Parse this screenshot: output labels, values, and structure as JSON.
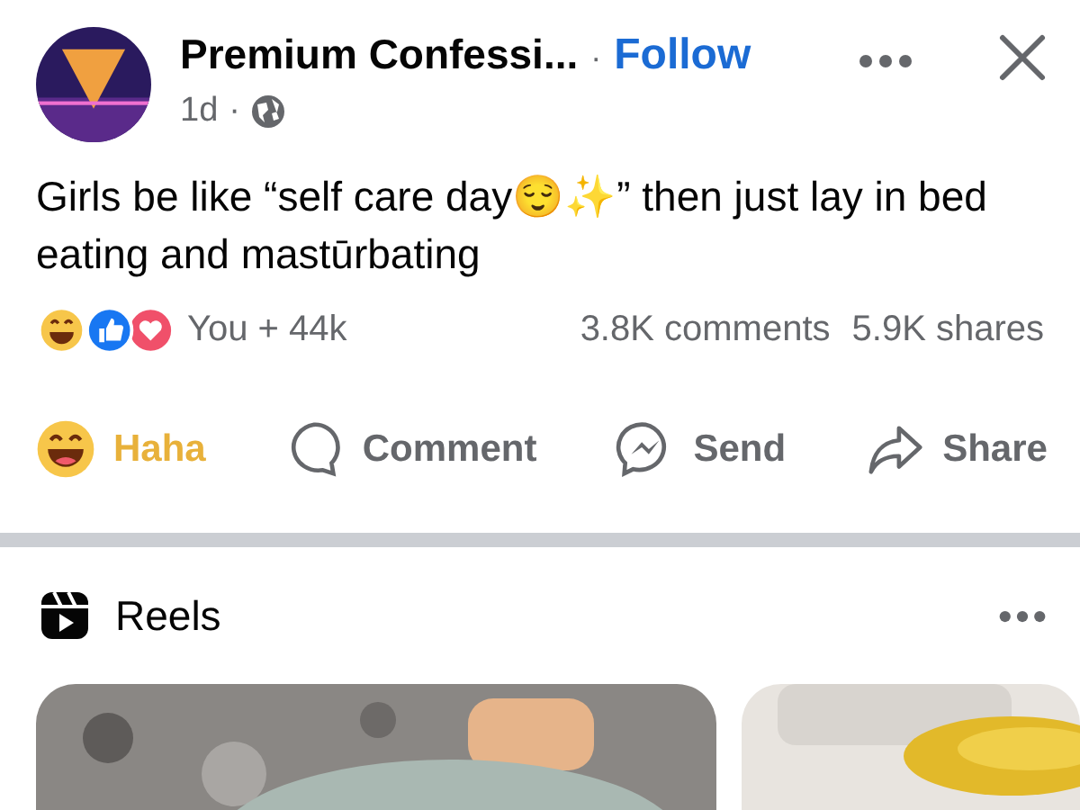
{
  "post": {
    "author": "Premium Confessi...",
    "separator": "·",
    "follow": "Follow",
    "time": "1d",
    "time_separator": "·",
    "text": "Girls be like “self care day😌✨” then just lay in bed eating and mastūrbating"
  },
  "reactions": {
    "summary": "You + 44k",
    "comments": "3.8K comments",
    "shares": "5.9K shares"
  },
  "actions": [
    {
      "kind": "haha",
      "label": "Haha",
      "selected": true
    },
    {
      "kind": "comment",
      "label": "Comment",
      "selected": false
    },
    {
      "kind": "send",
      "label": "Send",
      "selected": false
    },
    {
      "kind": "share",
      "label": "Share",
      "selected": false
    }
  ],
  "reels": {
    "title": "Reels"
  }
}
